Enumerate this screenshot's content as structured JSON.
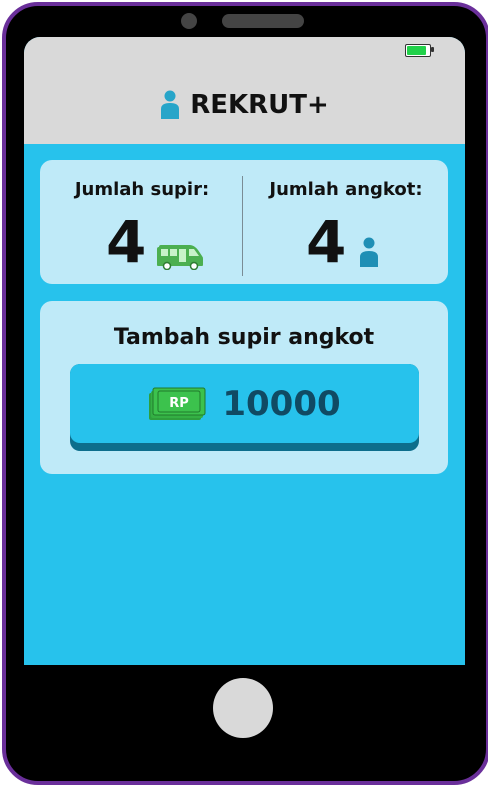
{
  "app": {
    "title": "REKRUT+"
  },
  "stats": {
    "drivers_label": "Jumlah supir:",
    "drivers_value": "4",
    "angkot_label": "Jumlah angkot:",
    "angkot_value": "4"
  },
  "action": {
    "title": "Tambah supir angkot",
    "price": "10000",
    "currency_badge": "RP"
  },
  "status_bar": {
    "battery_level": 0.85
  },
  "colors": {
    "frame": "#6a2f9a",
    "screen_bg": "#27c2ec",
    "card_bg": "#bfeaf8",
    "header_bg": "#d9d9d9",
    "button_face": "#27c2ec",
    "button_shadow": "#0d6e8c",
    "bus_green": "#4caf50",
    "person_blue": "#27a5c9",
    "battery_green": "#21d14a"
  },
  "icons": {
    "header": "person-icon",
    "drivers": "bus-icon",
    "angkot": "person-icon",
    "price": "money-icon"
  }
}
